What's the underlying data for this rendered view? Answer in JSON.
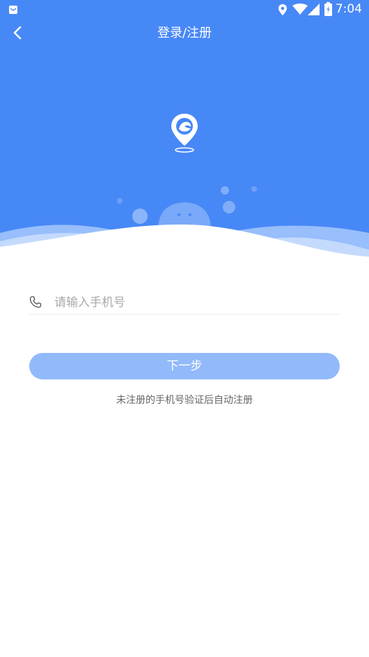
{
  "status_bar": {
    "time": "7:04",
    "icons": [
      "mail-icon",
      "location-icon",
      "wifi-icon",
      "signal-icon",
      "battery-icon"
    ]
  },
  "header": {
    "back_icon": "chevron-left-icon",
    "title": "登录/注册"
  },
  "hero": {
    "background_color": "#4788f7",
    "logo_icon": "map-pin-logo-icon"
  },
  "form": {
    "phone_icon": "phone-icon",
    "phone_placeholder": "请输入手机号",
    "phone_value": "",
    "next_button_label": "下一步",
    "next_button_color": "#92bafb",
    "hint": "未注册的手机号验证后自动注册"
  }
}
